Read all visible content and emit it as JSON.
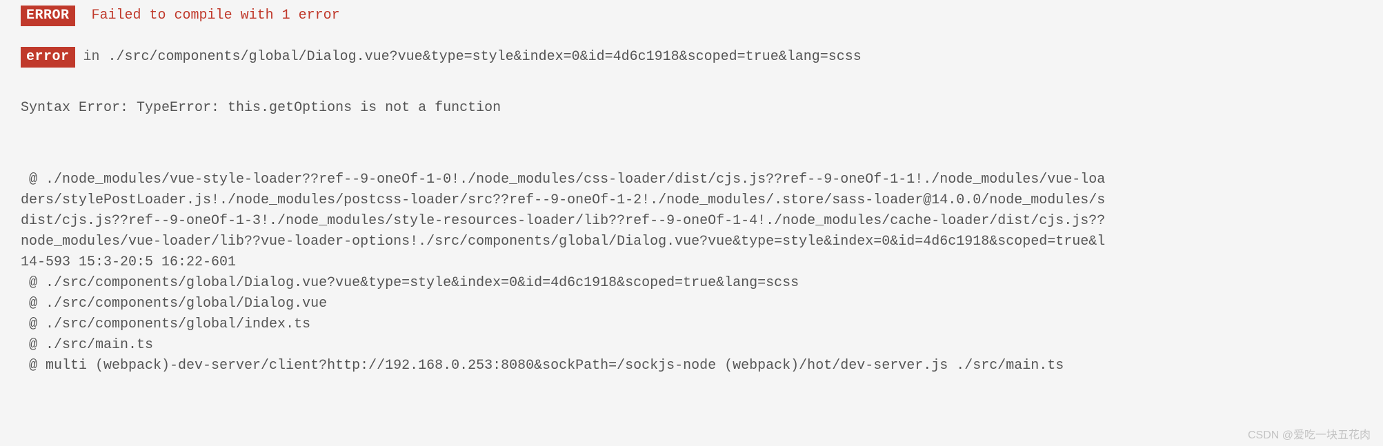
{
  "header": {
    "badge_upper": "ERROR",
    "failed_msg": "Failed to compile with 1 error"
  },
  "error_line": {
    "badge_lower": "error",
    "in_text": " in ",
    "path": "./src/components/global/Dialog.vue?vue&type=style&index=0&id=4d6c1918&scoped=true&lang=scss"
  },
  "syntax_error": "Syntax Error: TypeError: this.getOptions is not a function",
  "stack": {
    "l1": " @ ./node_modules/vue-style-loader??ref--9-oneOf-1-0!./node_modules/css-loader/dist/cjs.js??ref--9-oneOf-1-1!./node_modules/vue-loa",
    "l2": "ders/stylePostLoader.js!./node_modules/postcss-loader/src??ref--9-oneOf-1-2!./node_modules/.store/sass-loader@14.0.0/node_modules/s",
    "l3": "dist/cjs.js??ref--9-oneOf-1-3!./node_modules/style-resources-loader/lib??ref--9-oneOf-1-4!./node_modules/cache-loader/dist/cjs.js??",
    "l4": "node_modules/vue-loader/lib??vue-loader-options!./src/components/global/Dialog.vue?vue&type=style&index=0&id=4d6c1918&scoped=true&l",
    "l5": "14-593 15:3-20:5 16:22-601",
    "l6": " @ ./src/components/global/Dialog.vue?vue&type=style&index=0&id=4d6c1918&scoped=true&lang=scss",
    "l7": " @ ./src/components/global/Dialog.vue",
    "l8": " @ ./src/components/global/index.ts",
    "l9": " @ ./src/main.ts",
    "l10": " @ multi (webpack)-dev-server/client?http://192.168.0.253:8080&sockPath=/sockjs-node (webpack)/hot/dev-server.js ./src/main.ts"
  },
  "watermark": "CSDN @爱吃一块五花肉"
}
